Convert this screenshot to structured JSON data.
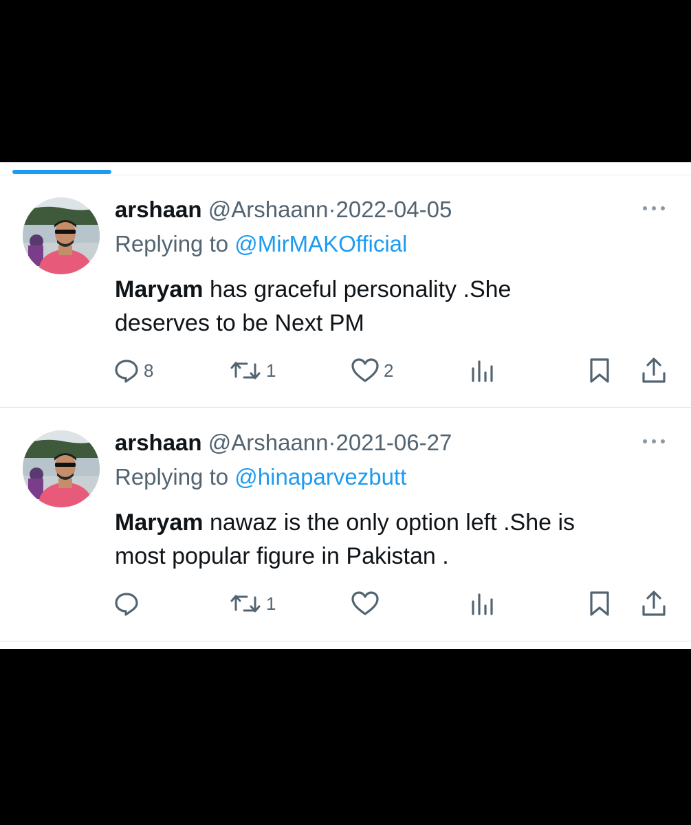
{
  "tweets": [
    {
      "display_name": "arshaan",
      "handle": "@Arshaann",
      "separator": "·",
      "date": "2022-04-05",
      "replying_label": "Replying to",
      "replying_handle": "@MirMAKOfficial",
      "text_bold": "Maryam",
      "text_line1": " has graceful personality .She",
      "text_line2": "deserves to be Next PM",
      "replies": "8",
      "retweets": "1",
      "likes": "2"
    },
    {
      "display_name": "arshaan",
      "handle": "@Arshaann",
      "separator": "·",
      "date": "2021-06-27",
      "replying_label": "Replying to",
      "replying_handle": "@hinaparvezbutt",
      "text_bold": "Maryam",
      "text_line1": " nawaz is the only option left .She is",
      "text_line2": "most popular figure in Pakistan .",
      "replies": "",
      "retweets": "1",
      "likes": ""
    }
  ],
  "icons": {
    "reply": "speech-bubble-icon",
    "retweet": "retweet-arrows-icon",
    "like": "heart-icon",
    "views": "bar-chart-icon",
    "bookmark": "bookmark-icon",
    "share": "share-upload-icon",
    "more": "ellipsis-icon"
  },
  "colors": {
    "accent": "#1d9bf0",
    "text": "#0f1419",
    "muted": "#536471"
  }
}
